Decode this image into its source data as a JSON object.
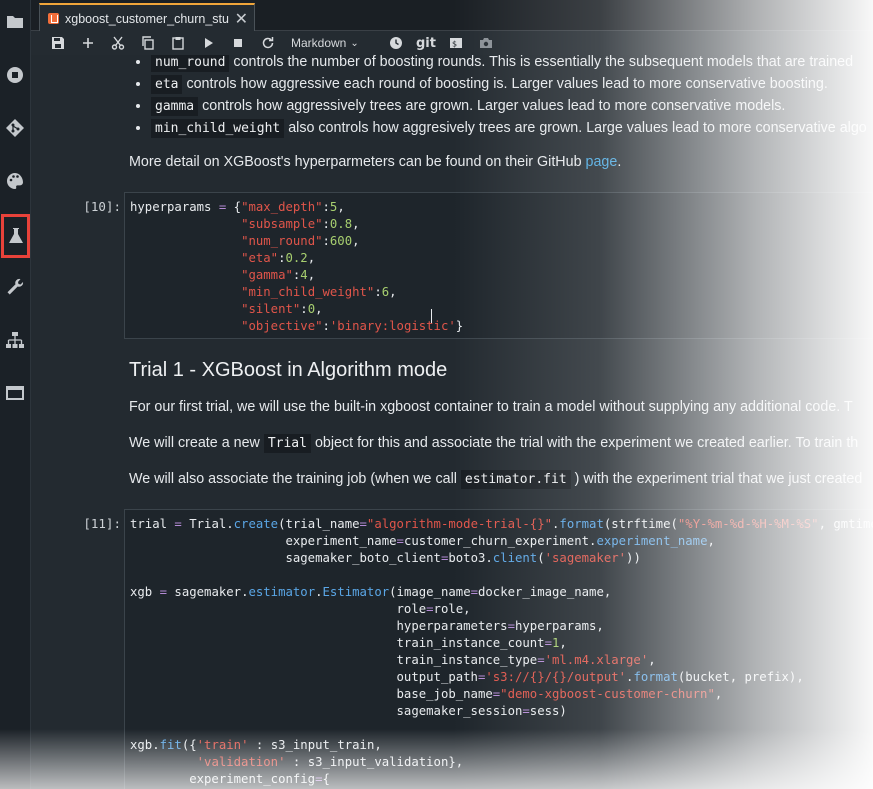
{
  "tab": {
    "title": "xgboost_customer_churn_stu"
  },
  "toolbar": {
    "cell_type": "Markdown",
    "git_label": "git"
  },
  "markdown_top": {
    "bullets": [
      {
        "code": "num_round",
        "text": " controls the number of boosting rounds. This is essentially the subsequent models that are trained"
      },
      {
        "code": "eta",
        "text": " controls how aggressive each round of boosting is. Larger values lead to more conservative boosting."
      },
      {
        "code": "gamma",
        "text": " controls how aggressively trees are grown. Larger values lead to more conservative models."
      },
      {
        "code": "min_child_weight",
        "text": " also controls how aggresively trees are grown. Large values lead to more conservative algo"
      }
    ],
    "more_detail": "More detail on XGBoost's hyperparmeters can be found on their GitHub ",
    "link": "page",
    "period": "."
  },
  "cell10": {
    "prompt": "[10]:",
    "lines": [
      [
        [
          "hyperparams ",
          ""
        ],
        [
          "=",
          "o"
        ],
        [
          " {",
          ""
        ],
        [
          "\"max_depth\"",
          "s"
        ],
        [
          ":",
          ""
        ],
        [
          "5",
          "n"
        ],
        [
          ",",
          ""
        ]
      ],
      [
        [
          "               ",
          ""
        ],
        [
          "\"subsample\"",
          "s"
        ],
        [
          ":",
          ""
        ],
        [
          "0.8",
          "n"
        ],
        [
          ",",
          ""
        ]
      ],
      [
        [
          "               ",
          ""
        ],
        [
          "\"num_round\"",
          "s"
        ],
        [
          ":",
          ""
        ],
        [
          "600",
          "n"
        ],
        [
          ",",
          ""
        ]
      ],
      [
        [
          "               ",
          ""
        ],
        [
          "\"eta\"",
          "s"
        ],
        [
          ":",
          ""
        ],
        [
          "0.2",
          "n"
        ],
        [
          ",",
          ""
        ]
      ],
      [
        [
          "               ",
          ""
        ],
        [
          "\"gamma\"",
          "s"
        ],
        [
          ":",
          ""
        ],
        [
          "4",
          "n"
        ],
        [
          ",",
          ""
        ]
      ],
      [
        [
          "               ",
          ""
        ],
        [
          "\"min_child_weight\"",
          "s"
        ],
        [
          ":",
          ""
        ],
        [
          "6",
          "n"
        ],
        [
          ",",
          ""
        ]
      ],
      [
        [
          "               ",
          ""
        ],
        [
          "\"silent\"",
          "s"
        ],
        [
          ":",
          ""
        ],
        [
          "0",
          "n"
        ],
        [
          ",",
          ""
        ]
      ],
      [
        [
          "               ",
          ""
        ],
        [
          "\"objective\"",
          "s"
        ],
        [
          ":",
          ""
        ],
        [
          "'binary:logistic'",
          "s"
        ],
        [
          "}",
          ""
        ]
      ]
    ]
  },
  "section": {
    "heading": "Trial 1 - XGBoost in Algorithm mode",
    "p1": "For our first trial, we will use the built-in xgboost container to train a model without supplying any additional code. T",
    "p2_pre": "We will create a new ",
    "p2_code": "Trial",
    "p2_post": " object for this and associate the trial with the experiment we created earlier. To train th",
    "p3_pre": "We will also associate the training job (when we call ",
    "p3_code": "estimator.fit",
    "p3_post": " ) with the experiment trial that we just created"
  },
  "cell11": {
    "prompt": "[11]:",
    "lines": [
      [
        [
          "trial ",
          ""
        ],
        [
          "=",
          "o"
        ],
        [
          " Trial.",
          ""
        ],
        [
          "create",
          "f"
        ],
        [
          "(trial_name",
          ""
        ],
        [
          "=",
          "o"
        ],
        [
          "\"algorithm-mode-trial-{}\"",
          "s"
        ],
        [
          ".",
          ""
        ],
        [
          "format",
          "f"
        ],
        [
          "(strftime(",
          ""
        ],
        [
          "\"%Y-%m-%d-%H-%M-%S\"",
          "s"
        ],
        [
          ", gmtime()",
          ""
        ]
      ],
      [
        [
          "                     experiment_name",
          ""
        ],
        [
          "=",
          "o"
        ],
        [
          "customer_churn_experiment.",
          ""
        ],
        [
          "experiment_name",
          "f"
        ],
        [
          ",",
          ""
        ]
      ],
      [
        [
          "                     sagemaker_boto_client",
          ""
        ],
        [
          "=",
          "o"
        ],
        [
          "boto3.",
          ""
        ],
        [
          "client",
          "f"
        ],
        [
          "(",
          ""
        ],
        [
          "'sagemaker'",
          "s"
        ],
        [
          "))",
          ""
        ]
      ],
      [
        [
          "",
          ""
        ]
      ],
      [
        [
          "xgb ",
          ""
        ],
        [
          "=",
          "o"
        ],
        [
          " sagemaker.",
          ""
        ],
        [
          "estimator",
          "f"
        ],
        [
          ".",
          ""
        ],
        [
          "Estimator",
          "f"
        ],
        [
          "(image_name",
          ""
        ],
        [
          "=",
          "o"
        ],
        [
          "docker_image_name,",
          ""
        ]
      ],
      [
        [
          "                                    role",
          ""
        ],
        [
          "=",
          "o"
        ],
        [
          "role,",
          ""
        ]
      ],
      [
        [
          "                                    hyperparameters",
          ""
        ],
        [
          "=",
          "o"
        ],
        [
          "hyperparams,",
          ""
        ]
      ],
      [
        [
          "                                    train_instance_count",
          ""
        ],
        [
          "=",
          "o"
        ],
        [
          "1",
          "n"
        ],
        [
          ",",
          ""
        ]
      ],
      [
        [
          "                                    train_instance_type",
          ""
        ],
        [
          "=",
          "o"
        ],
        [
          "'ml.m4.xlarge'",
          "s"
        ],
        [
          ",",
          ""
        ]
      ],
      [
        [
          "                                    output_path",
          ""
        ],
        [
          "=",
          "o"
        ],
        [
          "'s3://{}/{}/output'",
          "s"
        ],
        [
          ".",
          ""
        ],
        [
          "format",
          "f"
        ],
        [
          "(bucket, prefix),",
          ""
        ]
      ],
      [
        [
          "                                    base_job_name",
          ""
        ],
        [
          "=",
          "o"
        ],
        [
          "\"demo-xgboost-customer-churn\"",
          "s"
        ],
        [
          ",",
          ""
        ]
      ],
      [
        [
          "                                    sagemaker_session",
          ""
        ],
        [
          "=",
          "o"
        ],
        [
          "sess)",
          ""
        ]
      ],
      [
        [
          "",
          ""
        ]
      ],
      [
        [
          "xgb.",
          ""
        ],
        [
          "fit",
          "f"
        ],
        [
          "({",
          ""
        ],
        [
          "'train'",
          "s"
        ],
        [
          " : s3_input_train,",
          ""
        ]
      ],
      [
        [
          "         ",
          ""
        ],
        [
          "'validation'",
          "s"
        ],
        [
          " : s3_input_validation},",
          ""
        ]
      ],
      [
        [
          "        experiment_config",
          ""
        ],
        [
          "=",
          "o"
        ],
        [
          "{",
          ""
        ]
      ]
    ]
  }
}
